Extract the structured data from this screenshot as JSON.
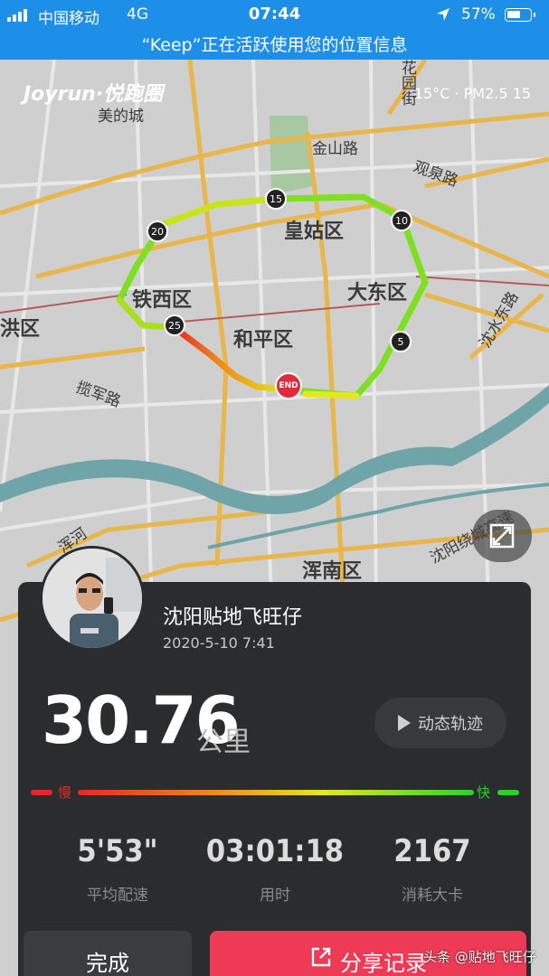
{
  "status_bar": {
    "carrier": "中国移动",
    "network": "4G",
    "time": "07:44",
    "battery_text": "57%",
    "battery_level": 0.57,
    "location_banner": "“Keep”正在活跃使用您的位置信息"
  },
  "map": {
    "brand": "Joyrun·悦跑圈",
    "weather": "15°C · PM2.5 15",
    "labels": {
      "meide": "美的城",
      "jinshan": "金山路",
      "guanquan": "观泉路",
      "huagu": "皇姑区",
      "dadong": "大东区",
      "tiexi": "铁西区",
      "heping": "和平区",
      "hong": "洪区",
      "lanjun": "揽军路",
      "shenshui": "沈水东路",
      "huayuan": "花园街",
      "hunnan": "浑南区",
      "raocheng": "沈阳绕城高速",
      "hunhe": "浑河"
    },
    "km_markers": [
      "5",
      "10",
      "15",
      "20",
      "25"
    ],
    "end_label": "END",
    "route_color_slow": "#e5272b",
    "route_color_fast": "#2bd12b"
  },
  "card": {
    "username": "沈阳贴地飞旺仔",
    "datetime": "2020-5-10 7:41",
    "distance": "30.76",
    "distance_unit": "公里",
    "replay_label": "动态轨迹",
    "speed_slow": "慢",
    "speed_fast": "快",
    "stats": [
      {
        "value": "5'53\"",
        "label": "平均配速"
      },
      {
        "value": "03:01:18",
        "label": "用时"
      },
      {
        "value": "2167",
        "label": "消耗大卡"
      }
    ],
    "done_label": "完成",
    "share_label": "分享记录"
  },
  "watermark": "头条 @贴地飞旺仔"
}
